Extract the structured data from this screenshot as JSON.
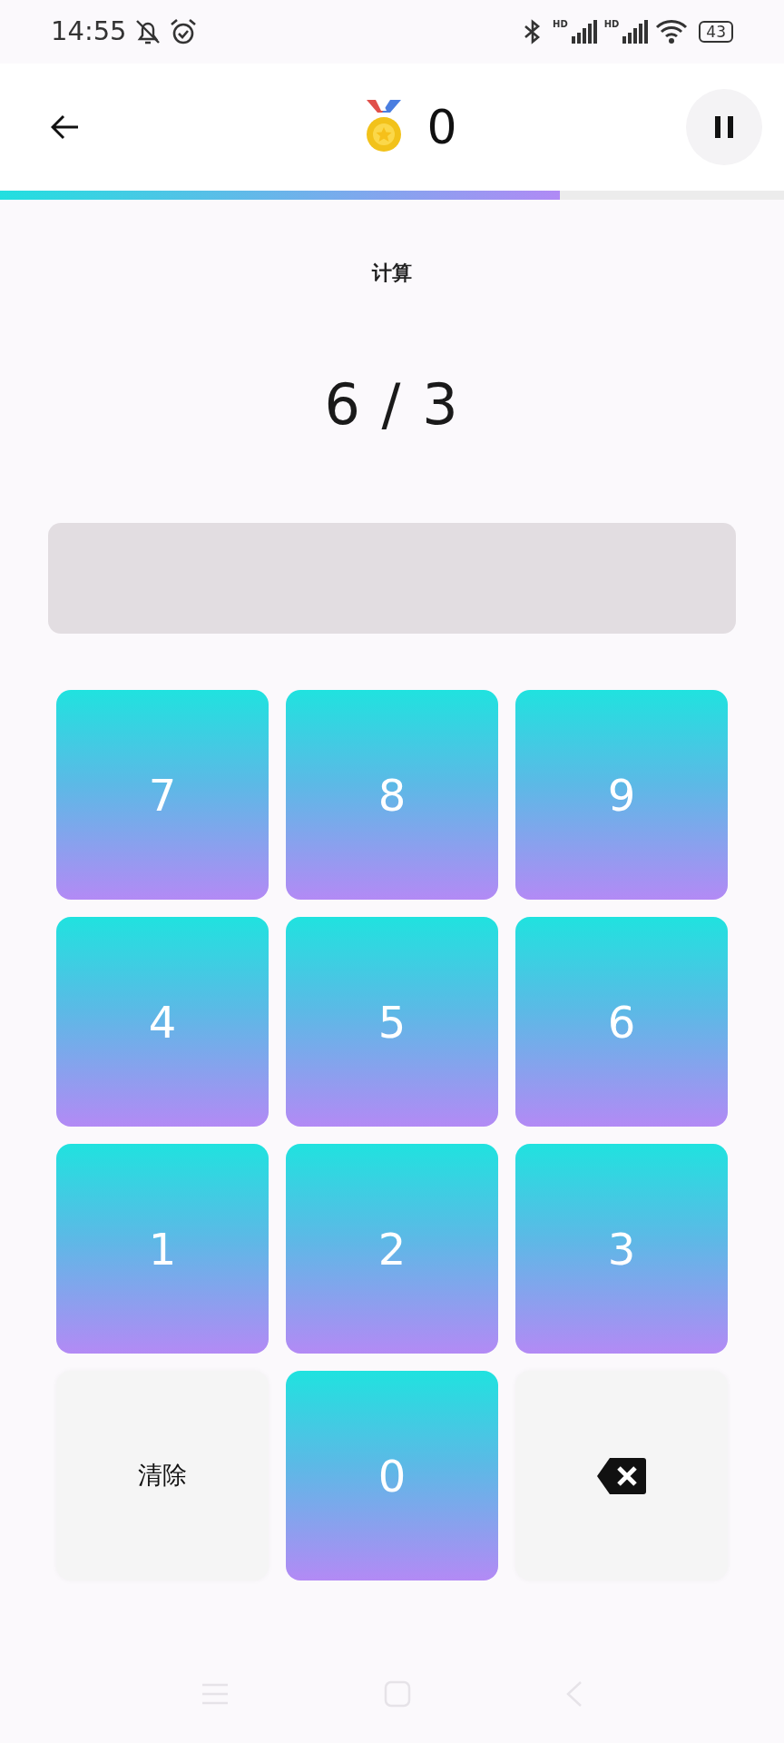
{
  "status_bar": {
    "time": "14:55",
    "signals": [
      {
        "label": "HD"
      },
      {
        "label": "HD"
      }
    ],
    "battery": "43"
  },
  "header": {
    "score": "0",
    "progress": {
      "level": 0.714
    }
  },
  "task": {
    "title": "计算",
    "question": "6 / 3"
  },
  "keys": [
    {
      "kind": "digit",
      "label": "7"
    },
    {
      "kind": "digit",
      "label": "8"
    },
    {
      "kind": "digit",
      "label": "9"
    },
    {
      "kind": "digit",
      "label": "4"
    },
    {
      "kind": "digit",
      "label": "5"
    },
    {
      "kind": "digit",
      "label": "6"
    },
    {
      "kind": "digit",
      "label": "1"
    },
    {
      "kind": "digit",
      "label": "2"
    },
    {
      "kind": "digit",
      "label": "3"
    },
    {
      "kind": "clear",
      "label": "清除"
    },
    {
      "kind": "digit",
      "label": "0"
    },
    {
      "kind": "backspace"
    }
  ]
}
